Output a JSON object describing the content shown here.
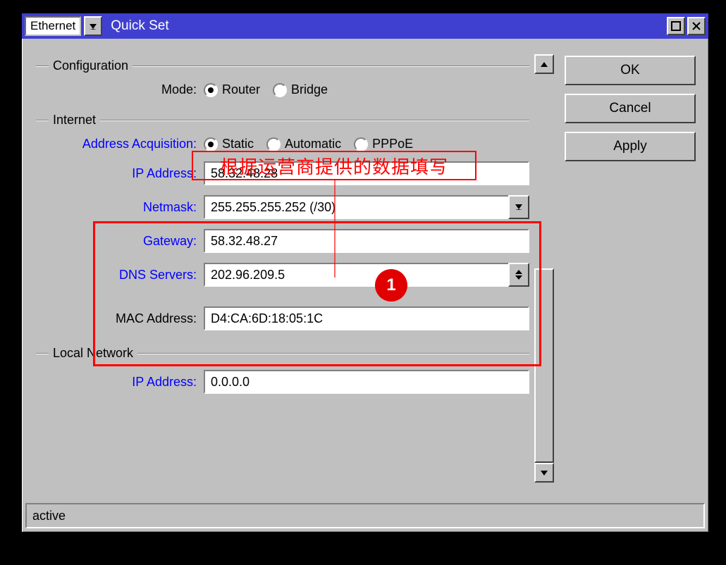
{
  "titlebar": {
    "mode_select": "Ethernet",
    "title": "Quick Set"
  },
  "buttons": {
    "ok": "OK",
    "cancel": "Cancel",
    "apply": "Apply"
  },
  "groups": {
    "configuration": "Configuration",
    "internet": "Internet",
    "local_network": "Local Network"
  },
  "configuration": {
    "mode_label": "Mode:",
    "mode_options": {
      "router": "Router",
      "bridge": "Bridge"
    },
    "mode_selected": "router"
  },
  "internet": {
    "addr_acq_label": "Address Acquisition:",
    "addr_acq_options": {
      "static": "Static",
      "automatic": "Automatic",
      "pppoe": "PPPoE"
    },
    "addr_acq_selected": "static",
    "ip_label": "IP Address:",
    "ip_value": "58.32.48.28",
    "netmask_label": "Netmask:",
    "netmask_value": "255.255.255.252 (/30)",
    "gateway_label": "Gateway:",
    "gateway_value": "58.32.48.27",
    "dns_label": "DNS Servers:",
    "dns_value": "202.96.209.5",
    "mac_label": "MAC Address:",
    "mac_value": "D4:CA:6D:18:05:1C"
  },
  "local_network": {
    "ip_label": "IP Address:",
    "ip_value": "0.0.0.0"
  },
  "status": "active",
  "annotation": {
    "text": "根据运营商提供的数据填写",
    "number": "1"
  }
}
